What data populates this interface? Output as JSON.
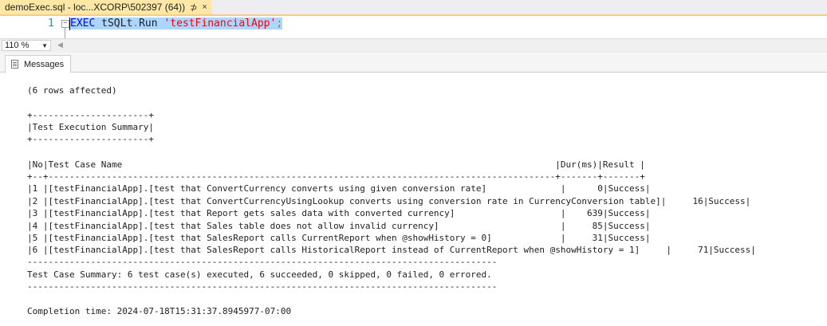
{
  "document_tab": {
    "title": "demoExec.sql - loc...XCORP\\502397 (64))",
    "pin_icon": "pin-icon",
    "close_icon": "close-icon"
  },
  "editor": {
    "line_number": "1",
    "code": {
      "keyword": "EXEC",
      "object": "tSQLt",
      "dot": ".",
      "method": "Run",
      "string": "'testFinancialApp'",
      "semicolon": ";"
    }
  },
  "zoom": {
    "value": "110 %"
  },
  "results": {
    "messages_tab_label": "Messages",
    "lines": {
      "rows_affected": "(6 rows affected)",
      "box_border_top": "+----------------------+",
      "box_title": "|Test Execution Summary|",
      "box_border_bottom": "+----------------------+",
      "header": "|No|Test Case Name                                                                                  |Dur(ms)|Result |",
      "header_sep": "+--+------------------------------------------------------------------------------------------------+-------+-------+",
      "footer_sep_1": "-----------------------------------------------------------------------------------------",
      "summary": "Test Case Summary: 6 test case(s) executed, 6 succeeded, 0 skipped, 0 failed, 0 errored.",
      "footer_sep_2": "-----------------------------------------------------------------------------------------",
      "completion": "Completion time: 2024-07-18T15:31:37.8945977-07:00"
    },
    "rows": [
      "|1 |[testFinancialApp].[test that ConvertCurrency converts using given conversion rate]              |      0|Success|",
      "|2 |[testFinancialApp].[test that ConvertCurrencyUsingLookup converts using conversion rate in CurrencyConversion table]|     16|Success|",
      "|3 |[testFinancialApp].[test that Report gets sales data with converted currency]                    |    639|Success|",
      "|4 |[testFinancialApp].[test that Sales table does not allow invalid currency]                       |     85|Success|",
      "|5 |[testFinancialApp].[test that SalesReport calls CurrentReport when @showHistory = 0]             |     31|Success|",
      "|6 |[testFinancialApp].[test that SalesReport calls HistoricalReport instead of CurrentReport when @showHistory = 1]     |     71|Success|"
    ]
  }
}
